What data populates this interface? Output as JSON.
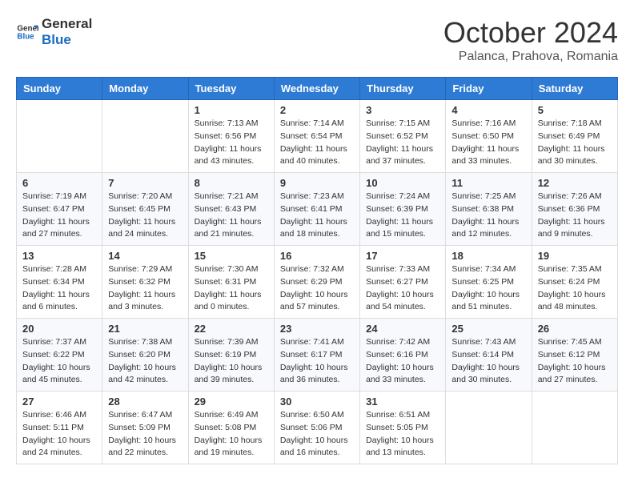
{
  "logo": {
    "line1": "General",
    "line2": "Blue"
  },
  "title": "October 2024",
  "subtitle": "Palanca, Prahova, Romania",
  "weekdays": [
    "Sunday",
    "Monday",
    "Tuesday",
    "Wednesday",
    "Thursday",
    "Friday",
    "Saturday"
  ],
  "weeks": [
    [
      {
        "day": "",
        "sunrise": "",
        "sunset": "",
        "daylight": ""
      },
      {
        "day": "",
        "sunrise": "",
        "sunset": "",
        "daylight": ""
      },
      {
        "day": "1",
        "sunrise": "Sunrise: 7:13 AM",
        "sunset": "Sunset: 6:56 PM",
        "daylight": "Daylight: 11 hours and 43 minutes."
      },
      {
        "day": "2",
        "sunrise": "Sunrise: 7:14 AM",
        "sunset": "Sunset: 6:54 PM",
        "daylight": "Daylight: 11 hours and 40 minutes."
      },
      {
        "day": "3",
        "sunrise": "Sunrise: 7:15 AM",
        "sunset": "Sunset: 6:52 PM",
        "daylight": "Daylight: 11 hours and 37 minutes."
      },
      {
        "day": "4",
        "sunrise": "Sunrise: 7:16 AM",
        "sunset": "Sunset: 6:50 PM",
        "daylight": "Daylight: 11 hours and 33 minutes."
      },
      {
        "day": "5",
        "sunrise": "Sunrise: 7:18 AM",
        "sunset": "Sunset: 6:49 PM",
        "daylight": "Daylight: 11 hours and 30 minutes."
      }
    ],
    [
      {
        "day": "6",
        "sunrise": "Sunrise: 7:19 AM",
        "sunset": "Sunset: 6:47 PM",
        "daylight": "Daylight: 11 hours and 27 minutes."
      },
      {
        "day": "7",
        "sunrise": "Sunrise: 7:20 AM",
        "sunset": "Sunset: 6:45 PM",
        "daylight": "Daylight: 11 hours and 24 minutes."
      },
      {
        "day": "8",
        "sunrise": "Sunrise: 7:21 AM",
        "sunset": "Sunset: 6:43 PM",
        "daylight": "Daylight: 11 hours and 21 minutes."
      },
      {
        "day": "9",
        "sunrise": "Sunrise: 7:23 AM",
        "sunset": "Sunset: 6:41 PM",
        "daylight": "Daylight: 11 hours and 18 minutes."
      },
      {
        "day": "10",
        "sunrise": "Sunrise: 7:24 AM",
        "sunset": "Sunset: 6:39 PM",
        "daylight": "Daylight: 11 hours and 15 minutes."
      },
      {
        "day": "11",
        "sunrise": "Sunrise: 7:25 AM",
        "sunset": "Sunset: 6:38 PM",
        "daylight": "Daylight: 11 hours and 12 minutes."
      },
      {
        "day": "12",
        "sunrise": "Sunrise: 7:26 AM",
        "sunset": "Sunset: 6:36 PM",
        "daylight": "Daylight: 11 hours and 9 minutes."
      }
    ],
    [
      {
        "day": "13",
        "sunrise": "Sunrise: 7:28 AM",
        "sunset": "Sunset: 6:34 PM",
        "daylight": "Daylight: 11 hours and 6 minutes."
      },
      {
        "day": "14",
        "sunrise": "Sunrise: 7:29 AM",
        "sunset": "Sunset: 6:32 PM",
        "daylight": "Daylight: 11 hours and 3 minutes."
      },
      {
        "day": "15",
        "sunrise": "Sunrise: 7:30 AM",
        "sunset": "Sunset: 6:31 PM",
        "daylight": "Daylight: 11 hours and 0 minutes."
      },
      {
        "day": "16",
        "sunrise": "Sunrise: 7:32 AM",
        "sunset": "Sunset: 6:29 PM",
        "daylight": "Daylight: 10 hours and 57 minutes."
      },
      {
        "day": "17",
        "sunrise": "Sunrise: 7:33 AM",
        "sunset": "Sunset: 6:27 PM",
        "daylight": "Daylight: 10 hours and 54 minutes."
      },
      {
        "day": "18",
        "sunrise": "Sunrise: 7:34 AM",
        "sunset": "Sunset: 6:25 PM",
        "daylight": "Daylight: 10 hours and 51 minutes."
      },
      {
        "day": "19",
        "sunrise": "Sunrise: 7:35 AM",
        "sunset": "Sunset: 6:24 PM",
        "daylight": "Daylight: 10 hours and 48 minutes."
      }
    ],
    [
      {
        "day": "20",
        "sunrise": "Sunrise: 7:37 AM",
        "sunset": "Sunset: 6:22 PM",
        "daylight": "Daylight: 10 hours and 45 minutes."
      },
      {
        "day": "21",
        "sunrise": "Sunrise: 7:38 AM",
        "sunset": "Sunset: 6:20 PM",
        "daylight": "Daylight: 10 hours and 42 minutes."
      },
      {
        "day": "22",
        "sunrise": "Sunrise: 7:39 AM",
        "sunset": "Sunset: 6:19 PM",
        "daylight": "Daylight: 10 hours and 39 minutes."
      },
      {
        "day": "23",
        "sunrise": "Sunrise: 7:41 AM",
        "sunset": "Sunset: 6:17 PM",
        "daylight": "Daylight: 10 hours and 36 minutes."
      },
      {
        "day": "24",
        "sunrise": "Sunrise: 7:42 AM",
        "sunset": "Sunset: 6:16 PM",
        "daylight": "Daylight: 10 hours and 33 minutes."
      },
      {
        "day": "25",
        "sunrise": "Sunrise: 7:43 AM",
        "sunset": "Sunset: 6:14 PM",
        "daylight": "Daylight: 10 hours and 30 minutes."
      },
      {
        "day": "26",
        "sunrise": "Sunrise: 7:45 AM",
        "sunset": "Sunset: 6:12 PM",
        "daylight": "Daylight: 10 hours and 27 minutes."
      }
    ],
    [
      {
        "day": "27",
        "sunrise": "Sunrise: 6:46 AM",
        "sunset": "Sunset: 5:11 PM",
        "daylight": "Daylight: 10 hours and 24 minutes."
      },
      {
        "day": "28",
        "sunrise": "Sunrise: 6:47 AM",
        "sunset": "Sunset: 5:09 PM",
        "daylight": "Daylight: 10 hours and 22 minutes."
      },
      {
        "day": "29",
        "sunrise": "Sunrise: 6:49 AM",
        "sunset": "Sunset: 5:08 PM",
        "daylight": "Daylight: 10 hours and 19 minutes."
      },
      {
        "day": "30",
        "sunrise": "Sunrise: 6:50 AM",
        "sunset": "Sunset: 5:06 PM",
        "daylight": "Daylight: 10 hours and 16 minutes."
      },
      {
        "day": "31",
        "sunrise": "Sunrise: 6:51 AM",
        "sunset": "Sunset: 5:05 PM",
        "daylight": "Daylight: 10 hours and 13 minutes."
      },
      {
        "day": "",
        "sunrise": "",
        "sunset": "",
        "daylight": ""
      },
      {
        "day": "",
        "sunrise": "",
        "sunset": "",
        "daylight": ""
      }
    ]
  ]
}
